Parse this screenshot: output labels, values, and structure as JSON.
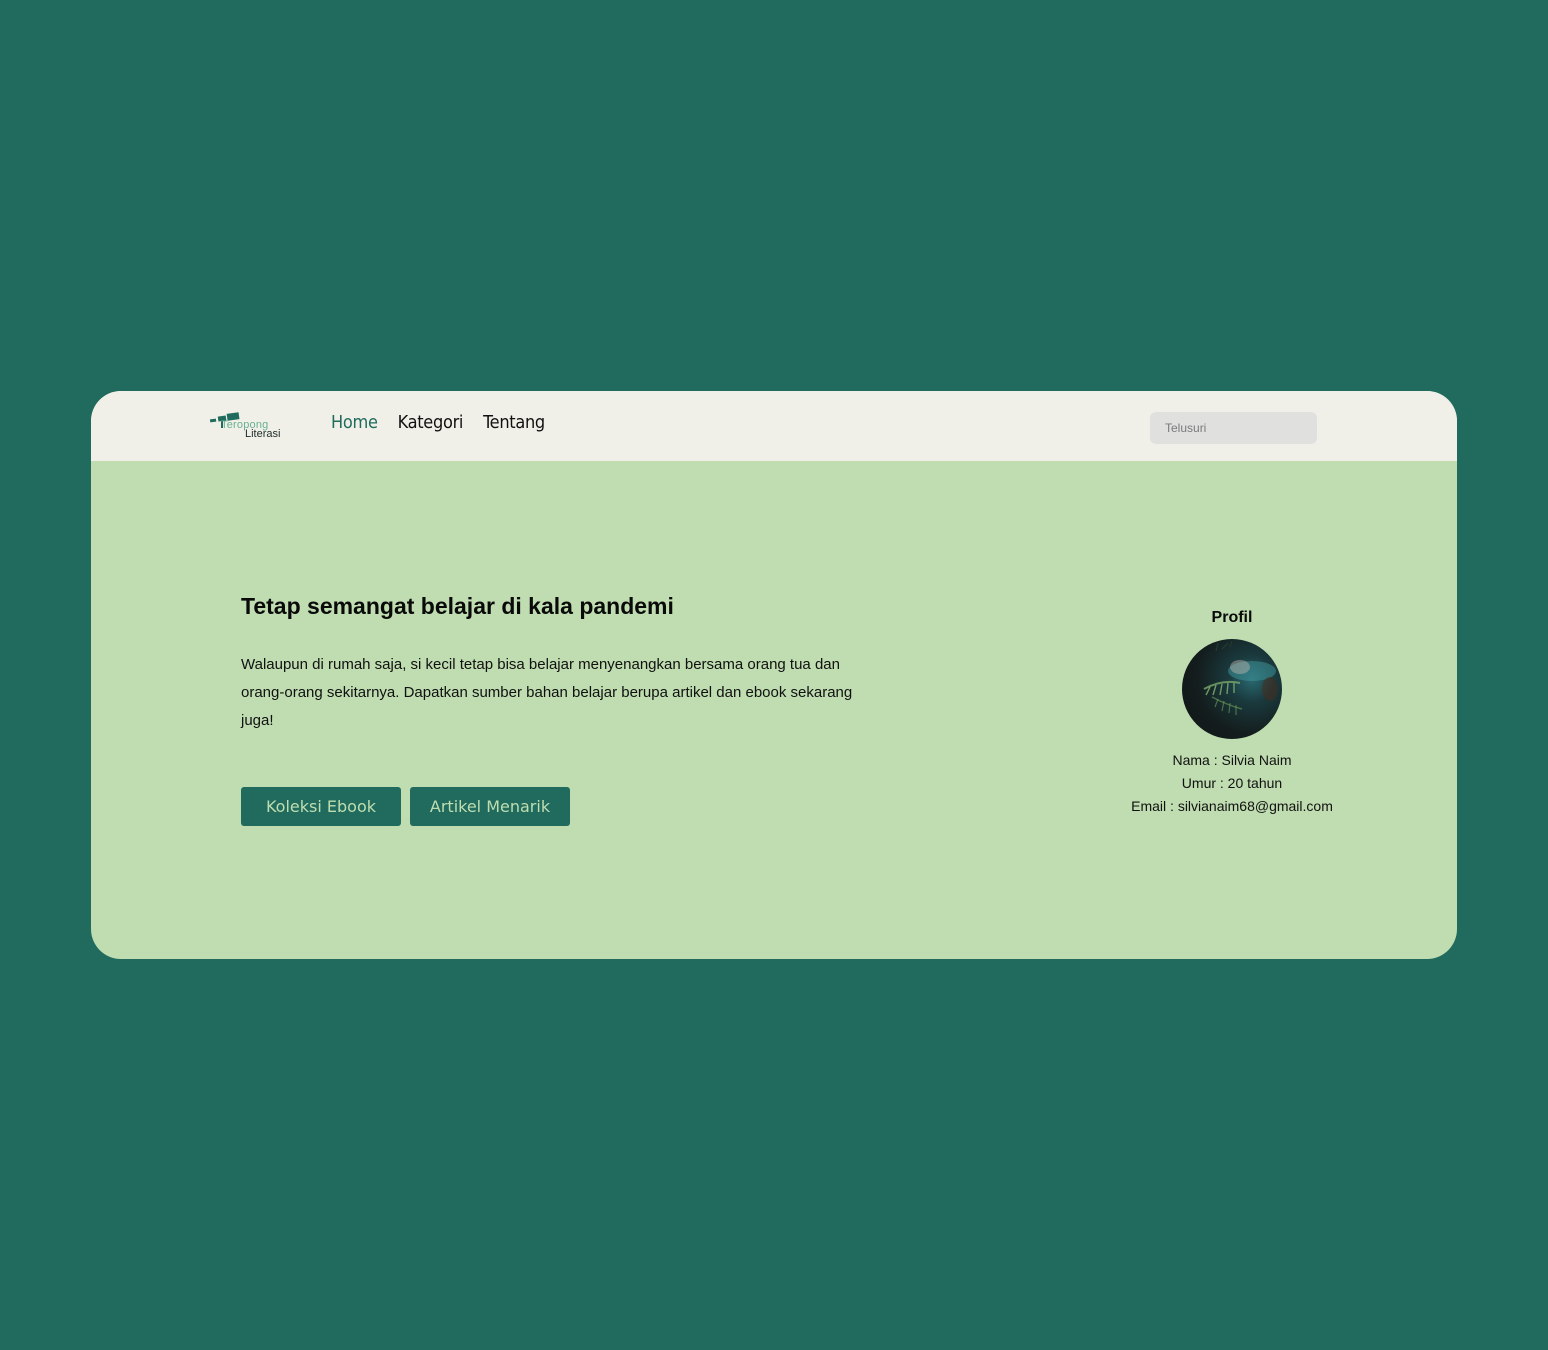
{
  "brand": {
    "line1": "Teropong",
    "line2": "Literasi"
  },
  "nav": {
    "items": [
      {
        "label": "Home",
        "active": true
      },
      {
        "label": "Kategori",
        "active": false
      },
      {
        "label": "Tentang",
        "active": false
      }
    ]
  },
  "search": {
    "placeholder": "Telusuri",
    "value": ""
  },
  "hero": {
    "title": "Tetap semangat belajar di kala pandemi",
    "description": "Walaupun di rumah saja, si kecil tetap bisa belajar menyenangkan bersama orang tua dan orang-orang sekitarnya. Dapatkan sumber bahan belajar berupa artikel dan ebook sekarang juga!",
    "buttons": {
      "ebook": "Koleksi Ebook",
      "artikel": "Artikel Menarik"
    }
  },
  "profile": {
    "title": "Profil",
    "name": "Nama : Silvia Naim",
    "age": "Umur : 20 tahun",
    "email": "Email : silvianaim68@gmail.com"
  },
  "colors": {
    "page_background": "#206b5e",
    "navbar_background": "#f0f0e8",
    "content_background": "#bfddb0",
    "accent": "#206b5e",
    "button_text": "#bfddb0",
    "search_background": "#e0e1df"
  },
  "icons": {
    "logo": "telescope-logo-icon",
    "avatar": "profile-photo"
  }
}
